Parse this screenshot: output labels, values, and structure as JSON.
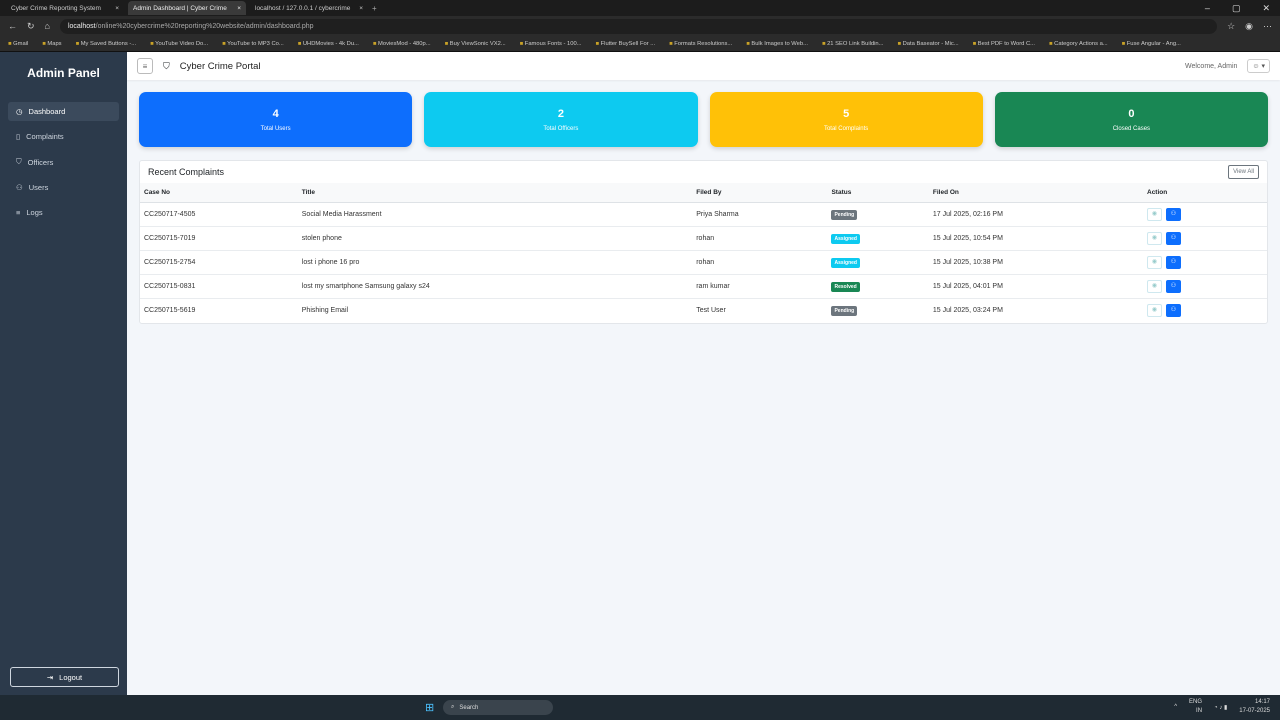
{
  "browser": {
    "tabs": [
      "Cyber Crime Reporting System",
      "Admin Dashboard | Cyber Crime",
      "localhost / 127.0.0.1 / cybercrime"
    ],
    "url_host": "localhost",
    "url_path": "/online%20cybercrime%20reporting%20website/admin/dashboard.php",
    "bookmarks": [
      "Gmail",
      "Maps",
      "My Saved Buttons -...",
      "YouTube Video Do...",
      "YouTube to MP3 Co...",
      "UHDMovies - 4k Du...",
      "MoviesMod - 480p...",
      "Buy ViewSonic VX2...",
      "Famous Fonts - 100...",
      "Flutter BuySell For ...",
      "Formats Resolutions...",
      "Bulk Images to Web...",
      "21 SEO Link Buildin...",
      "Data Baseator - Mic...",
      "Best PDF to Word C...",
      "Category Actions a...",
      "Fuse Angular - Ang..."
    ]
  },
  "sidebar": {
    "title": "Admin Panel",
    "items": [
      {
        "label": "Dashboard",
        "icon": "dashboard-icon"
      },
      {
        "label": "Complaints",
        "icon": "file-icon"
      },
      {
        "label": "Officers",
        "icon": "shield-icon"
      },
      {
        "label": "Users",
        "icon": "users-icon"
      },
      {
        "label": "Logs",
        "icon": "list-icon"
      }
    ],
    "logout": "Logout"
  },
  "header": {
    "brand": "Cyber Crime Portal",
    "welcome": "Welcome, Admin"
  },
  "stats": [
    {
      "value": "4",
      "label": "Total Users",
      "color": "#0d6efd"
    },
    {
      "value": "2",
      "label": "Total Officers",
      "color": "#0dcaf0"
    },
    {
      "value": "5",
      "label": "Total Complaints",
      "color": "#ffc107"
    },
    {
      "value": "0",
      "label": "Closed Cases",
      "color": "#198754"
    }
  ],
  "recent": {
    "title": "Recent Complaints",
    "view_all": "View All",
    "columns": [
      "Case No",
      "Title",
      "Filed By",
      "Status",
      "Filed On",
      "Action"
    ],
    "rows": [
      {
        "case": "CC250717-4505",
        "title": "Social Media Harassment",
        "by": "Priya Sharma",
        "status": "Pending",
        "color": "#6c757d",
        "on": "17 Jul 2025, 02:16 PM"
      },
      {
        "case": "CC250715-7019",
        "title": "stolen phone",
        "by": "rohan",
        "status": "Assigned",
        "color": "#0dcaf0",
        "on": "15 Jul 2025, 10:54 PM"
      },
      {
        "case": "CC250715-2754",
        "title": "lost i phone 16 pro",
        "by": "rohan",
        "status": "Assigned",
        "color": "#0dcaf0",
        "on": "15 Jul 2025, 10:38 PM"
      },
      {
        "case": "CC250715-0831",
        "title": "lost my smartphone Samsung galaxy s24",
        "by": "ram kumar",
        "status": "Resolved",
        "color": "#198754",
        "on": "15 Jul 2025, 04:01 PM"
      },
      {
        "case": "CC250715-5619",
        "title": "Phishing Email",
        "by": "Test User",
        "status": "Pending",
        "color": "#6c757d",
        "on": "15 Jul 2025, 03:24 PM"
      }
    ]
  },
  "taskbar": {
    "search": "Search",
    "lang": "ENG",
    "region": "IN",
    "time": "14:17",
    "date": "17-07-2025"
  }
}
